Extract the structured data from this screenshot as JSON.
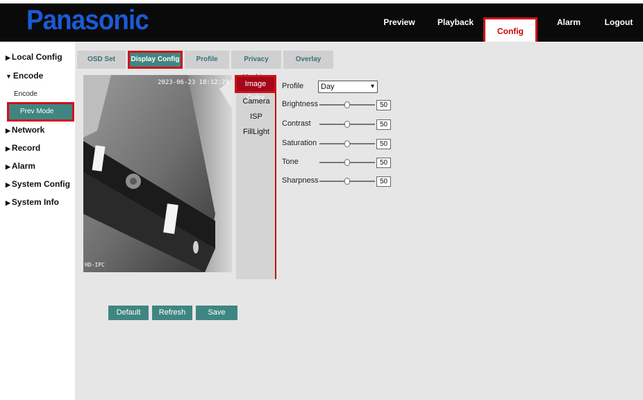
{
  "header": {
    "logo": "Panasonic",
    "nav": [
      "Preview",
      "Playback",
      "Config",
      "Alarm",
      "Logout"
    ],
    "active_nav": "Config"
  },
  "sidebar": {
    "items": [
      {
        "label": "Local Config",
        "arrow": "▶"
      },
      {
        "label": "Encode",
        "arrow": "▼"
      },
      {
        "label": "Network",
        "arrow": "▶"
      },
      {
        "label": "Record",
        "arrow": "▶"
      },
      {
        "label": "Alarm",
        "arrow": "▶"
      },
      {
        "label": "System Config",
        "arrow": "▶"
      },
      {
        "label": "System Info",
        "arrow": "▶"
      }
    ],
    "subitems": [
      "Encode",
      "Prev Mode"
    ]
  },
  "tabs": [
    "OSD Set",
    "Display Config",
    "Profile",
    "Privacy Masking",
    "Overlay"
  ],
  "video": {
    "timestamp": "2023-06-23 18:12:29",
    "channel_label": "HD-IPC"
  },
  "subtabs": [
    "Image Color",
    "Camera",
    "ISP",
    "FillLight"
  ],
  "form": {
    "profile_label": "Profile",
    "profile_value": "Day",
    "sliders": [
      {
        "label": "Brightness",
        "value": "50",
        "level": 0.5
      },
      {
        "label": "Contrast",
        "value": "50",
        "level": 0.5
      },
      {
        "label": "Saturation",
        "value": "50",
        "level": 0.5
      },
      {
        "label": "Tone",
        "value": "50",
        "level": 0.5
      },
      {
        "label": "Sharpness",
        "value": "50",
        "level": 0.5
      }
    ]
  },
  "buttons": [
    "Default",
    "Refresh",
    "Save"
  ],
  "colors": {
    "header_bg": "#0a0a0a",
    "logo": "#1a5bd6",
    "accent_teal": "#3f8682",
    "highlight_red": "#d0101a",
    "subtab_active": "#a3071a"
  }
}
